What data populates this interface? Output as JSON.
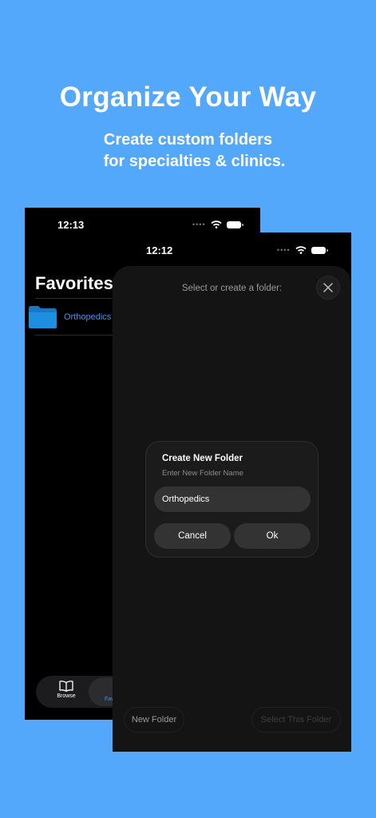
{
  "header": {
    "headline": "Organize Your Way",
    "subline_1": "Create custom folders",
    "subline_2": "for specialties & clinics."
  },
  "back_screen": {
    "time": "12:13",
    "title": "Favorites",
    "folders": [
      {
        "label": "Orthopedics",
        "icon": "folder-icon"
      }
    ],
    "tabbar": {
      "browse_label": "Browse",
      "favorites_label": "Fav"
    }
  },
  "front_screen": {
    "time": "12:12",
    "sheet_title": "Select or create a folder:",
    "dialog": {
      "title": "Create New Folder",
      "subtitle": "Enter New Folder Name",
      "input_value": "Orthopedics",
      "cancel_label": "Cancel",
      "ok_label": "Ok"
    },
    "new_folder_label": "New Folder",
    "select_folder_label": "Select This Folder"
  },
  "colors": {
    "background": "#53a8fc",
    "accent": "#3d95e8",
    "folder": "#1e8fe0"
  }
}
